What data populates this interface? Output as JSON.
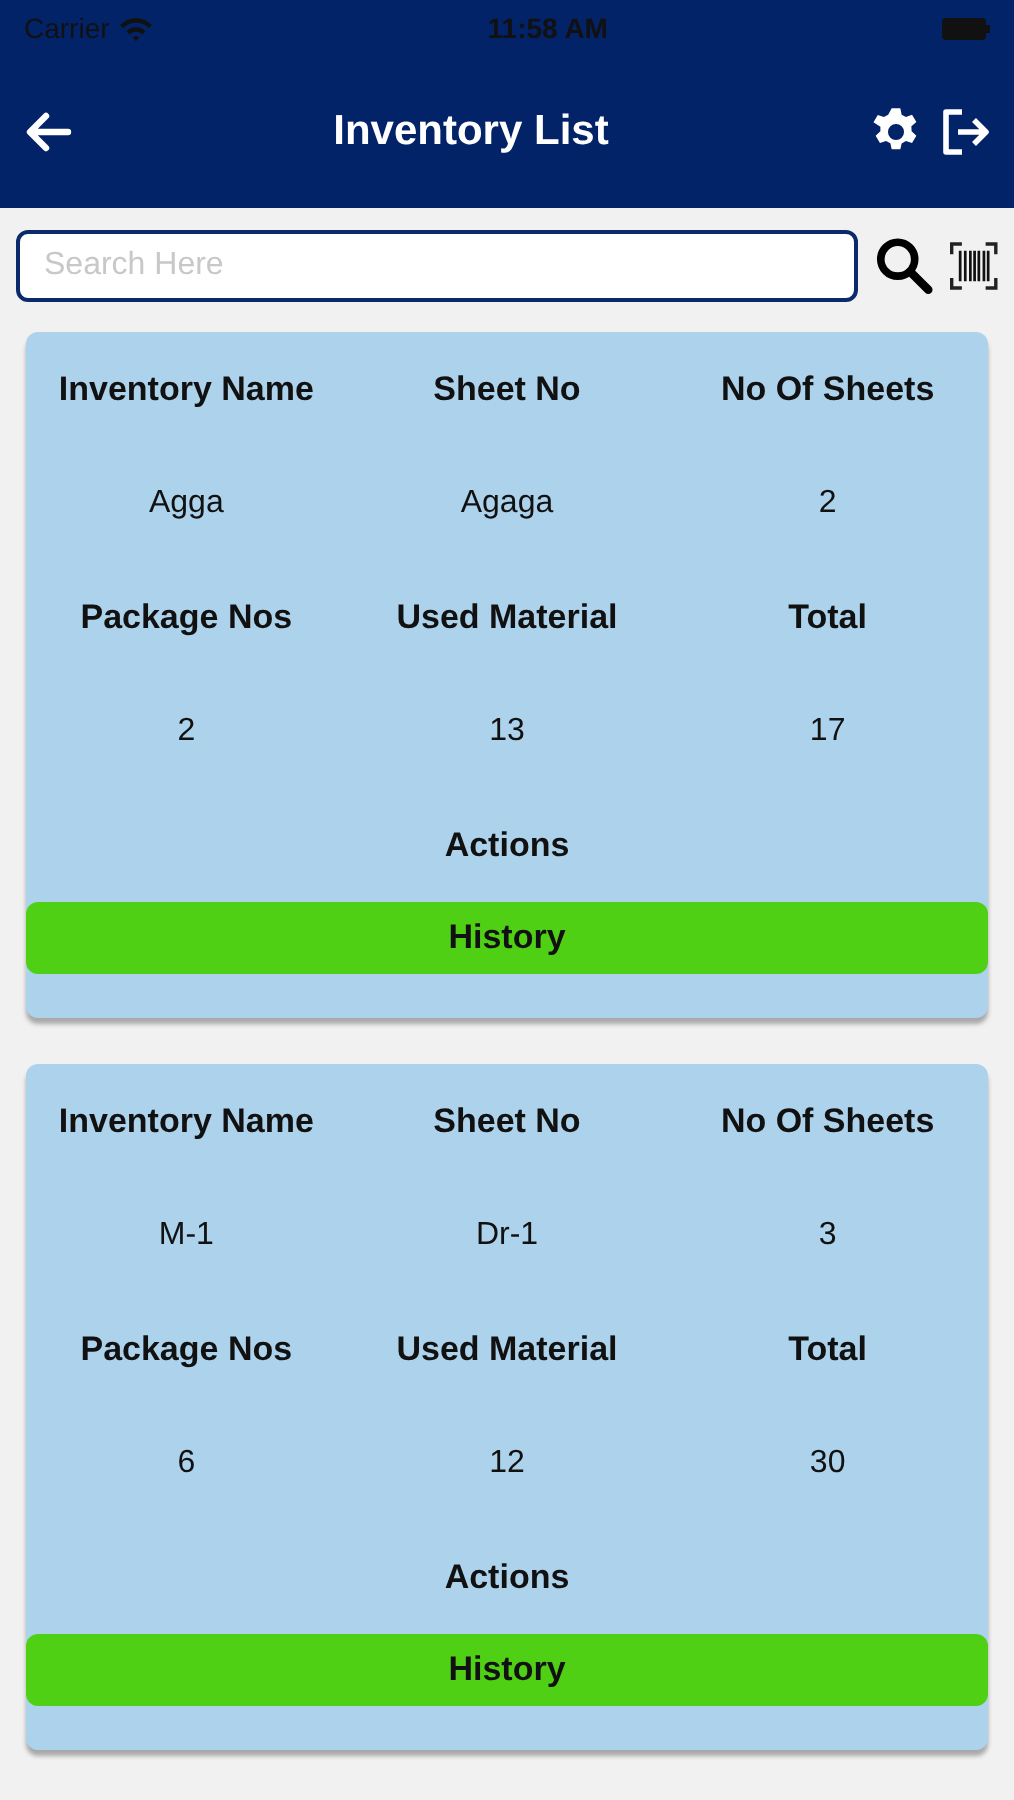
{
  "status_bar": {
    "carrier": "Carrier",
    "time": "11:58 AM"
  },
  "header": {
    "title": "Inventory List"
  },
  "search": {
    "placeholder": "Search Here"
  },
  "cards": [
    {
      "labels_1": [
        "Inventory Name",
        "Sheet No",
        "No Of Sheets"
      ],
      "values_1": [
        "Agga",
        "Agaga",
        "2"
      ],
      "labels_2": [
        "Package Nos",
        "Used Material",
        "Total"
      ],
      "values_2": [
        "2",
        "13",
        "17"
      ],
      "actions_label": "Actions",
      "button": "History"
    },
    {
      "labels_1": [
        "Inventory Name",
        "Sheet No",
        "No Of Sheets"
      ],
      "values_1": [
        "M-1",
        "Dr-1",
        "3"
      ],
      "labels_2": [
        "Package Nos",
        "Used Material",
        "Total"
      ],
      "values_2": [
        "6",
        "12",
        "30"
      ],
      "actions_label": "Actions",
      "button": "History"
    }
  ]
}
